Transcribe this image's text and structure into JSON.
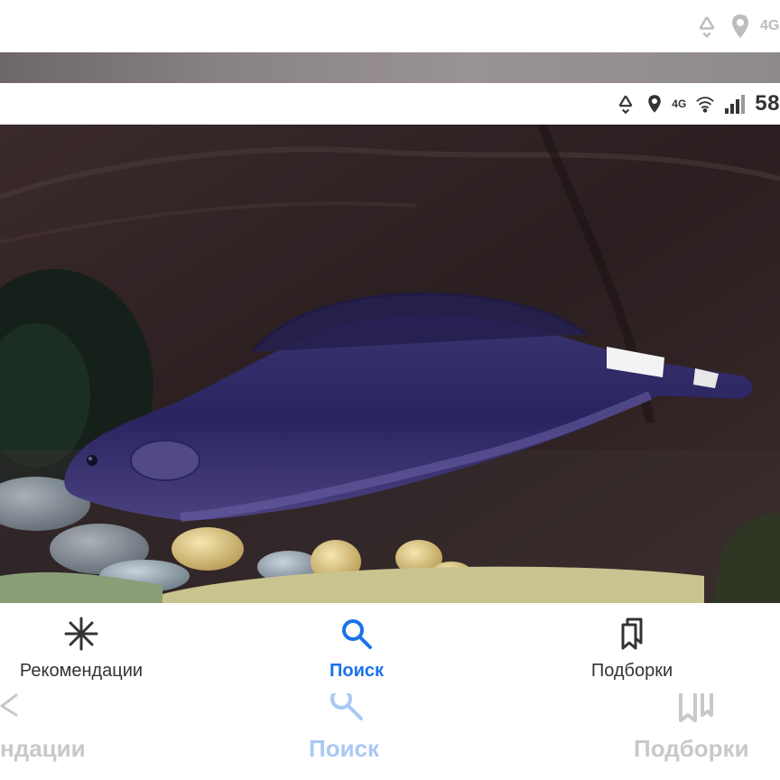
{
  "status_bar_top": {
    "icons": [
      "recycle-icon",
      "location-icon",
      "4g-icon"
    ],
    "network_label": "4G"
  },
  "status_bar": {
    "icons": [
      "recycle-icon",
      "location-icon",
      "wifi-icon",
      "signal-icon"
    ],
    "network_label": "4G",
    "battery": "58"
  },
  "photo": {
    "subject": "fish"
  },
  "bottom_nav": {
    "items": [
      {
        "label": "Рекомендации",
        "icon": "asterisk-icon",
        "active": false
      },
      {
        "label": "Поиск",
        "icon": "search-icon",
        "active": true
      },
      {
        "label": "Подборки",
        "icon": "bookmarks-icon",
        "active": false
      }
    ]
  },
  "ghost_nav": {
    "items": [
      {
        "label": "ндации"
      },
      {
        "label": "Поиск"
      },
      {
        "label": "Подборки"
      }
    ]
  },
  "colors": {
    "accent": "#1a73e8",
    "text": "#333333"
  }
}
